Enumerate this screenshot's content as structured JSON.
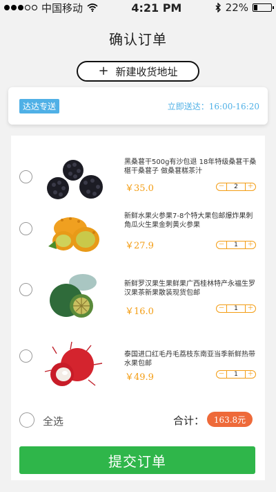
{
  "status_bar": {
    "carrier": "中国移动",
    "time": "4:21 PM",
    "battery": "22%",
    "battery_level": 0.22
  },
  "header": {
    "title": "确认订单"
  },
  "new_address": {
    "icon": "plus-icon",
    "label": "新建收货地址"
  },
  "delivery": {
    "badge": "达达专送",
    "time_text": "立即送达：16:00-16:20",
    "accent": "#4fb0e6"
  },
  "items": [
    {
      "desc": "黑桑葚干500g有沙包退 18年特级桑葚干桑椹干桑葚子 做桑葚糕茶汁",
      "price": "￥35.0",
      "qty": "2",
      "image": "blackberries"
    },
    {
      "desc": "新鲜水果火参果7-8个特大果包邮爆炸果刺角瓜火生果金刺黄火参果",
      "price": "￥27.9",
      "qty": "1",
      "image": "kiwano"
    },
    {
      "desc": "新鲜罗汉果生果鲜果广西桂林特产永福生罗汉果茶新果散装现货包邮",
      "price": "￥16.0",
      "qty": "1",
      "image": "luohan-fruit"
    },
    {
      "desc": "泰国进口红毛丹毛荔枝东南亚当季新鲜热带水果包邮",
      "price": "￥49.9",
      "qty": "1",
      "image": "rambutan"
    }
  ],
  "stepper": {
    "minus": "－",
    "plus": "＋"
  },
  "footer": {
    "select_all": "全选",
    "total_label": "合计：",
    "total_value": "163.8元",
    "submit": "提交订单"
  },
  "colors": {
    "price": "#f39c12",
    "total_pill": "#ee6a3a",
    "submit": "#2fb64a"
  }
}
